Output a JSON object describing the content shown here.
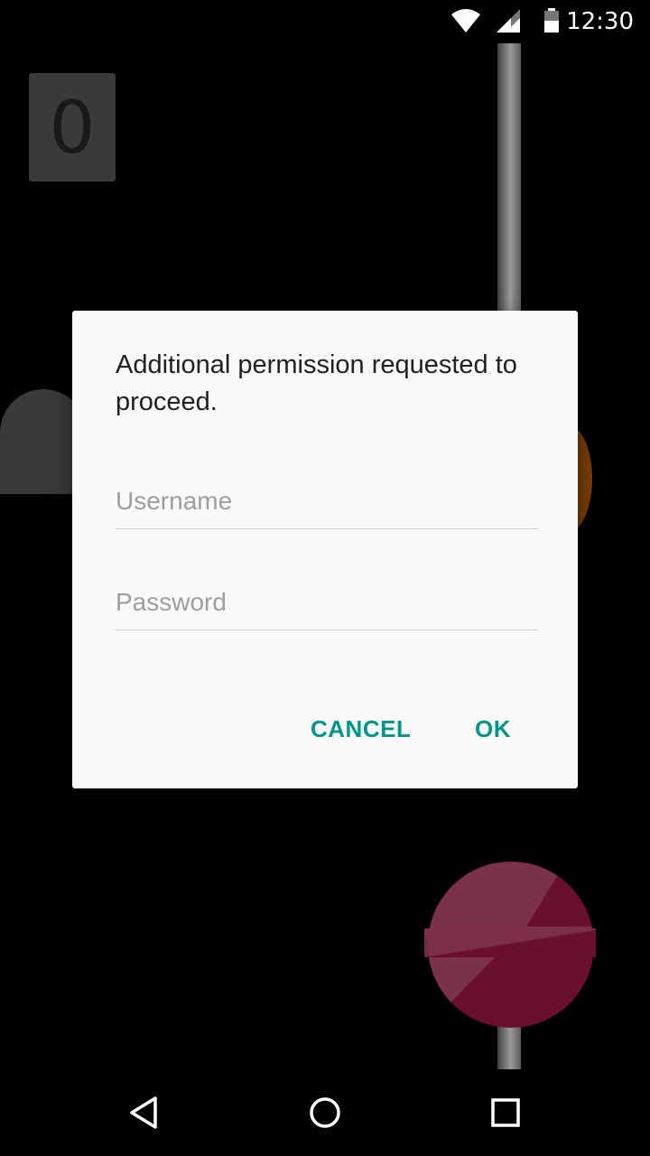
{
  "status_bar": {
    "time": "12:30",
    "icons": [
      "wifi-icon",
      "signal-icon",
      "battery-icon"
    ]
  },
  "game": {
    "score": "0",
    "colors": {
      "score_box": "#3a3a3a",
      "pole": "#8a8a8a",
      "ball": "#6b0f30",
      "ball_highlight": "#7b3148",
      "orange_obstacle": "#7a3e0a"
    }
  },
  "dialog": {
    "message": "Additional permission requested to proceed.",
    "username": {
      "placeholder": "Username",
      "value": ""
    },
    "password": {
      "placeholder": "Password",
      "value": ""
    },
    "cancel_label": "CANCEL",
    "ok_label": "OK",
    "accent_color": "#009688"
  },
  "nav_bar": {
    "icons": [
      "back-icon",
      "home-icon",
      "recents-icon"
    ]
  }
}
